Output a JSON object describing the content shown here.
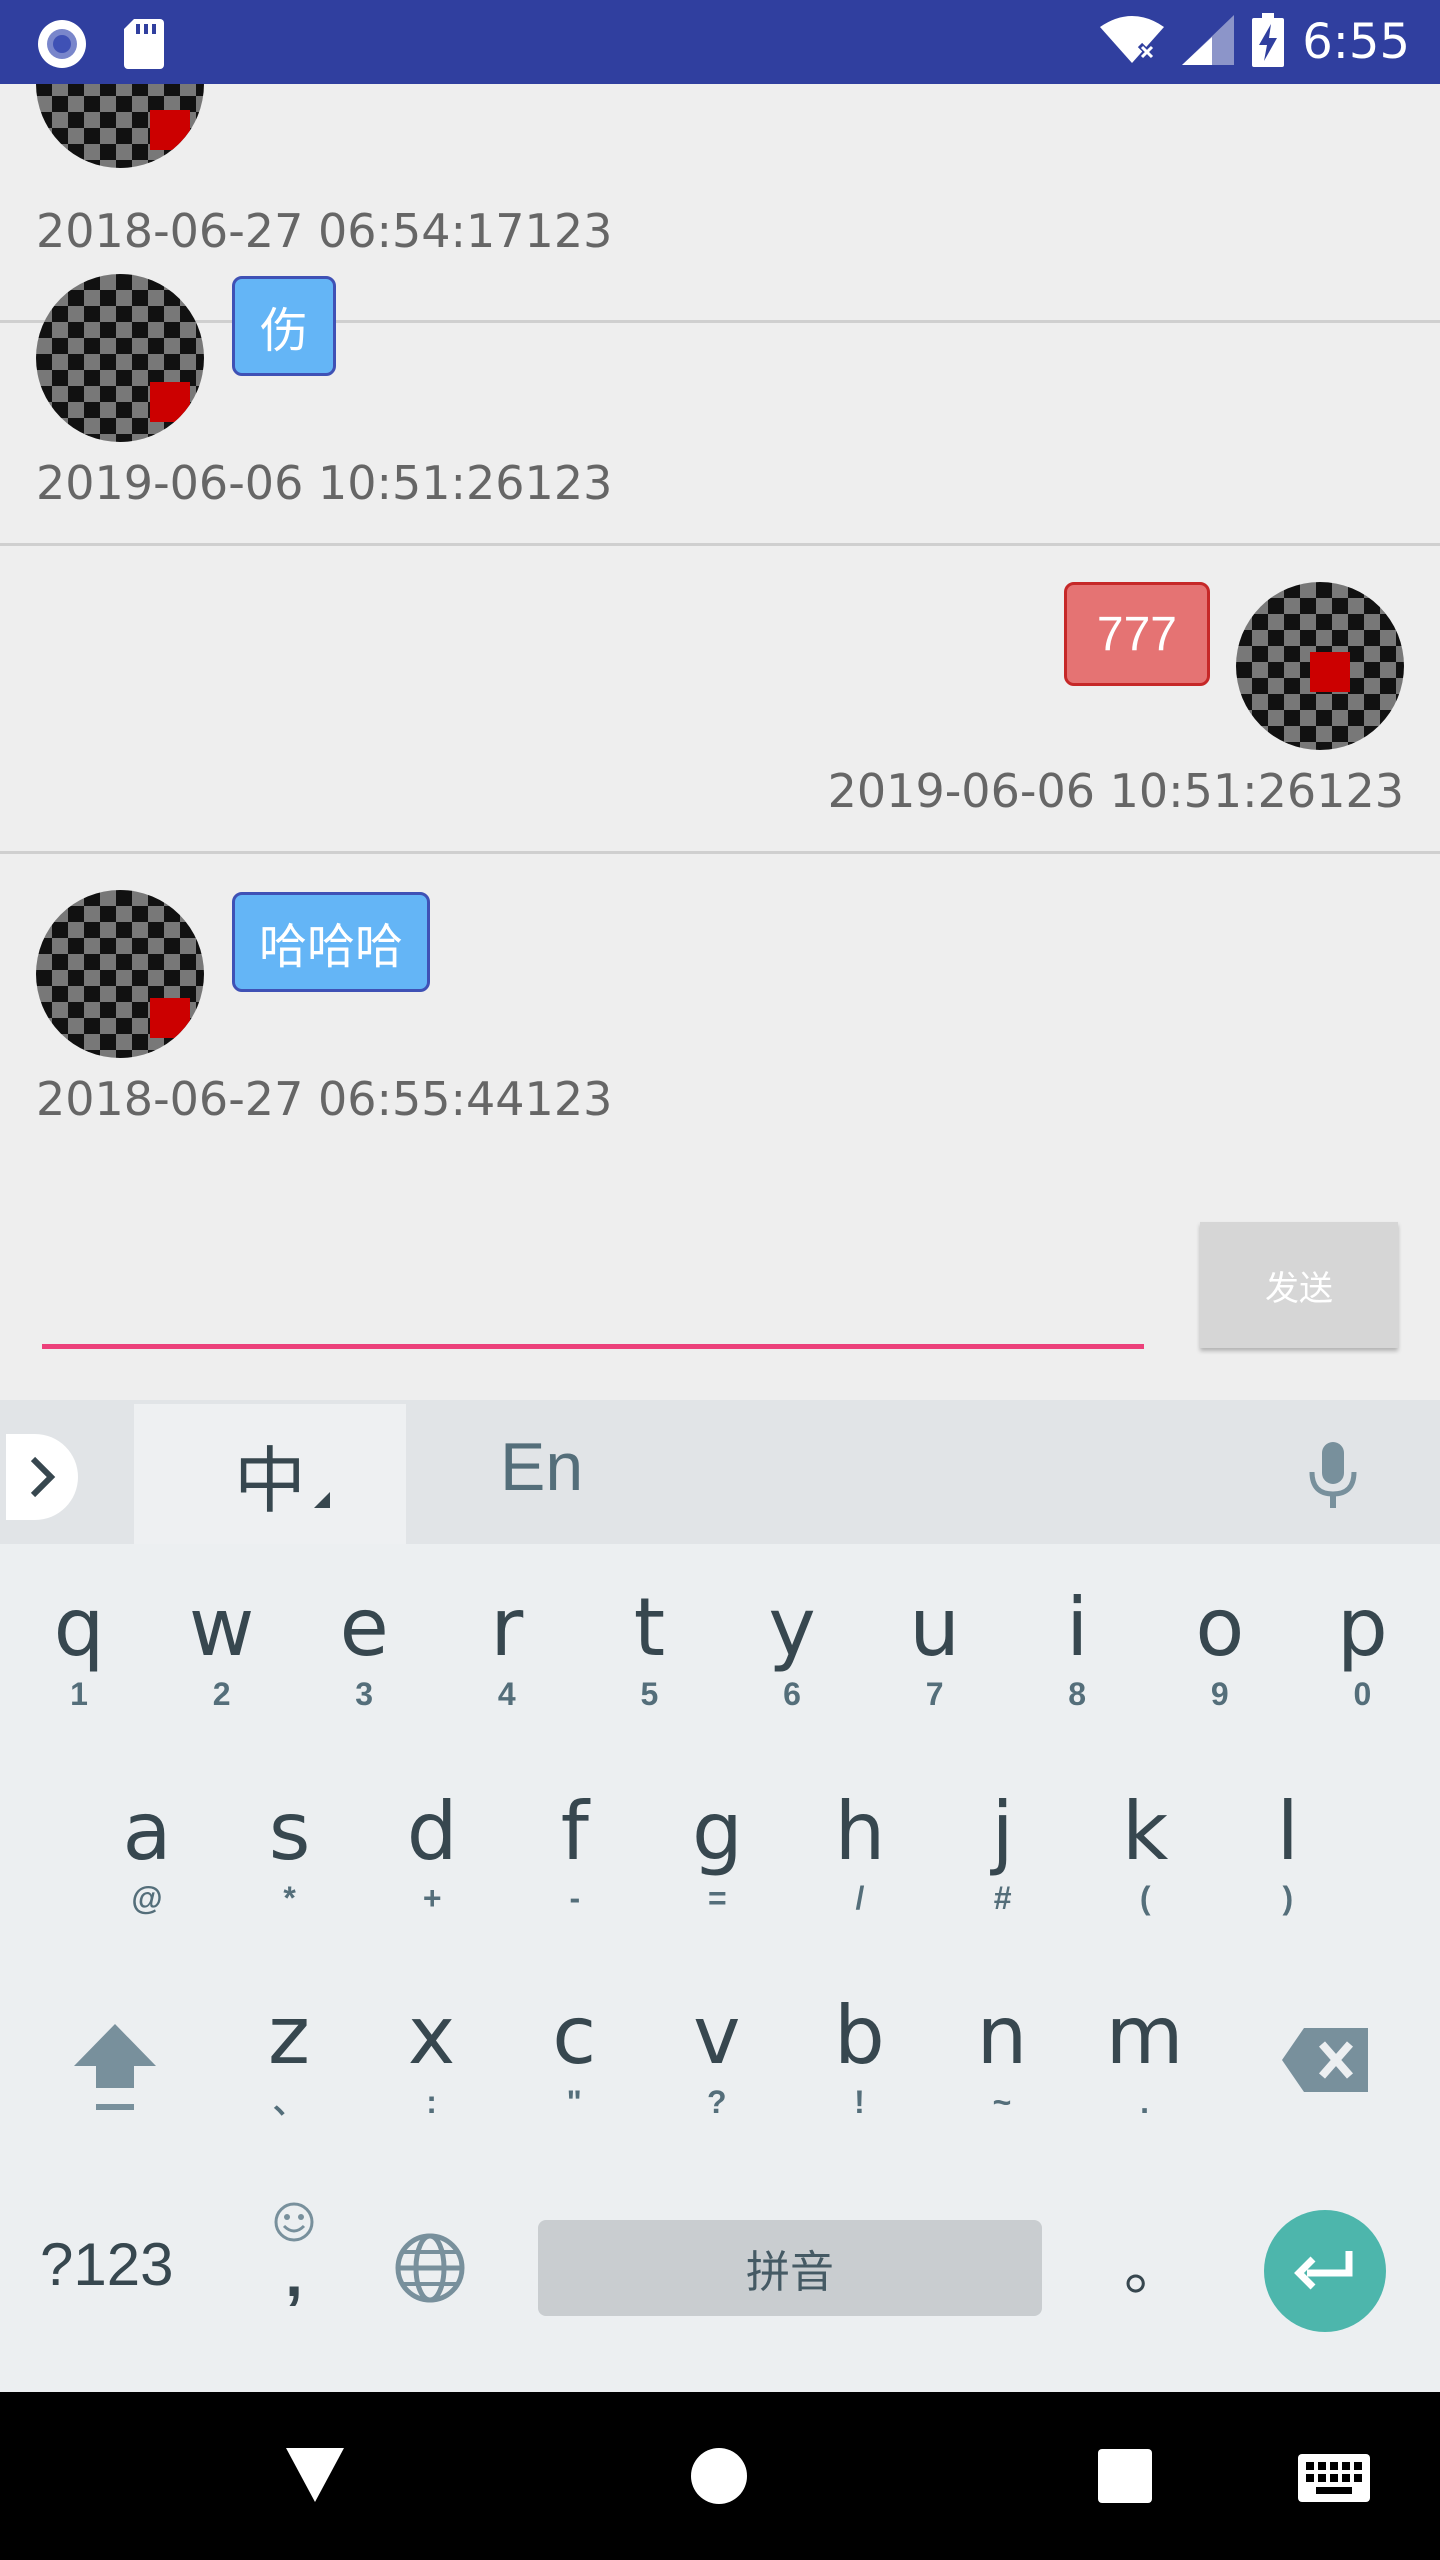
{
  "status_bar": {
    "time": "6:55"
  },
  "messages": [
    {
      "side": "left",
      "text": "",
      "timestamp": "2018-06-27 06:54:17123"
    },
    {
      "side": "left",
      "text": "伤",
      "timestamp": "2019-06-06 10:51:26123"
    },
    {
      "side": "right",
      "text": "777",
      "timestamp": "2019-06-06 10:51:26123"
    },
    {
      "side": "left",
      "text": "哈哈哈",
      "timestamp": "2018-06-27 06:55:44123"
    }
  ],
  "composer": {
    "input_value": "",
    "send_label": "发送"
  },
  "keyboard": {
    "lang_zh": "中",
    "lang_en": "En",
    "row1": [
      {
        "k": "q",
        "s": "1"
      },
      {
        "k": "w",
        "s": "2"
      },
      {
        "k": "e",
        "s": "3"
      },
      {
        "k": "r",
        "s": "4"
      },
      {
        "k": "t",
        "s": "5"
      },
      {
        "k": "y",
        "s": "6"
      },
      {
        "k": "u",
        "s": "7"
      },
      {
        "k": "i",
        "s": "8"
      },
      {
        "k": "o",
        "s": "9"
      },
      {
        "k": "p",
        "s": "0"
      }
    ],
    "row2": [
      {
        "k": "a",
        "s": "@"
      },
      {
        "k": "s",
        "s": "*"
      },
      {
        "k": "d",
        "s": "+"
      },
      {
        "k": "f",
        "s": "-"
      },
      {
        "k": "g",
        "s": "="
      },
      {
        "k": "h",
        "s": "/"
      },
      {
        "k": "j",
        "s": "#"
      },
      {
        "k": "k",
        "s": "("
      },
      {
        "k": "l",
        "s": ")"
      }
    ],
    "row3": [
      {
        "k": "z",
        "s": "、"
      },
      {
        "k": "x",
        "s": ":"
      },
      {
        "k": "c",
        "s": "\""
      },
      {
        "k": "v",
        "s": "?"
      },
      {
        "k": "b",
        "s": "!"
      },
      {
        "k": "n",
        "s": "~"
      },
      {
        "k": "m",
        "s": "."
      }
    ],
    "symbols_label": "?123",
    "comma_label": ",",
    "space_label": "拼音",
    "period_label": "。"
  },
  "colors": {
    "status_bar": "#303f9f",
    "incoming_bubble": "#64b5f6",
    "outgoing_bubble": "#e57373",
    "input_underline": "#ec407a",
    "enter_key": "#4db6ac"
  }
}
